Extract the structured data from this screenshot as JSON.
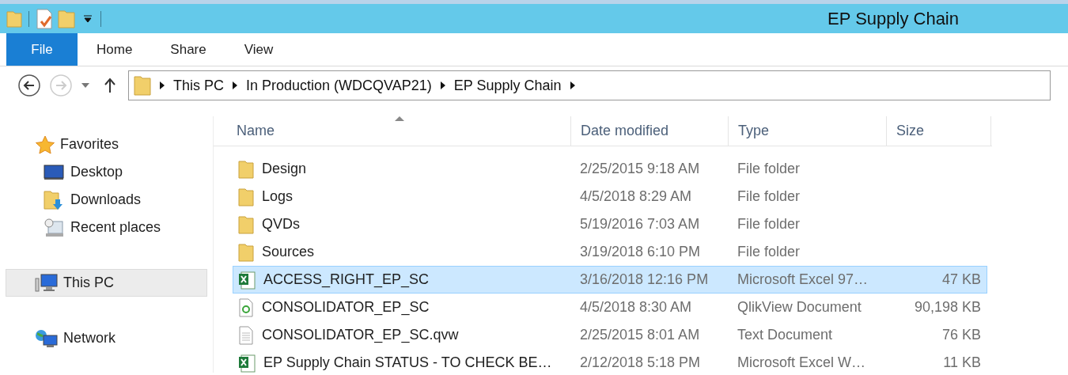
{
  "window": {
    "title": "EP Supply Chain"
  },
  "ribbon_tabs": [
    {
      "label": "File",
      "selected": true
    },
    {
      "label": "Home",
      "selected": false
    },
    {
      "label": "Share",
      "selected": false
    },
    {
      "label": "View",
      "selected": false
    }
  ],
  "breadcrumb": [
    "This PC",
    "In Production (WDCQVAP21)",
    "EP Supply Chain"
  ],
  "sidebar": {
    "groups": [
      {
        "label": "Favorites",
        "kind": "star",
        "selected": false,
        "children": [
          {
            "label": "Desktop",
            "kind": "desktop"
          },
          {
            "label": "Downloads",
            "kind": "downloads"
          },
          {
            "label": "Recent places",
            "kind": "recent"
          }
        ]
      },
      {
        "label": "This PC",
        "kind": "pc",
        "selected": true
      },
      {
        "label": "Network",
        "kind": "network",
        "selected": false
      }
    ]
  },
  "table": {
    "columns": [
      "Name",
      "Date modified",
      "Type",
      "Size"
    ],
    "rows": [
      {
        "kind": "folder",
        "name": "Design",
        "date": "2/25/2015 9:18 AM",
        "type": "File folder",
        "selected": false
      },
      {
        "kind": "folder",
        "name": "Logs",
        "date": "4/5/2018 8:29 AM",
        "type": "File folder",
        "selected": false
      },
      {
        "kind": "folder",
        "name": "QVDs",
        "date": "5/19/2016 7:03 AM",
        "type": "File folder",
        "selected": false
      },
      {
        "kind": "folder",
        "name": "Sources",
        "date": "3/19/2018 6:10 PM",
        "type": "File folder",
        "selected": false
      },
      {
        "kind": "excel",
        "name": "ACCESS_RIGHT_EP_SC",
        "date": "3/16/2018 12:16 PM",
        "type": "Microsoft Excel 97…",
        "size": "47 KB",
        "selected": true
      },
      {
        "kind": "qlik",
        "name": "CONSOLIDATOR_EP_SC",
        "date": "4/5/2018 8:30 AM",
        "type": "QlikView Document",
        "size": "90,198 KB",
        "selected": false
      },
      {
        "kind": "text",
        "name": "CONSOLIDATOR_EP_SC.qvw",
        "date": "2/25/2015 8:01 AM",
        "type": "Text Document",
        "size": "76 KB",
        "selected": false
      },
      {
        "kind": "excel",
        "name": "EP Supply Chain STATUS - TO CHECK BE…",
        "date": "2/12/2018 5:18 PM",
        "type": "Microsoft Excel W…",
        "size": "11 KB",
        "selected": false
      }
    ]
  }
}
